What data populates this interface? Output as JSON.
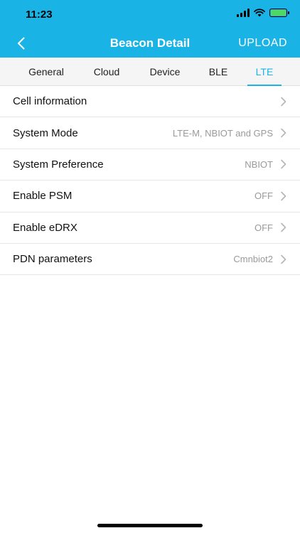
{
  "status_bar": {
    "time": "11:23"
  },
  "nav": {
    "title": "Beacon Detail",
    "action_label": "UPLOAD"
  },
  "tabs": [
    {
      "label": "General"
    },
    {
      "label": "Cloud"
    },
    {
      "label": "Device"
    },
    {
      "label": "BLE"
    },
    {
      "label": "LTE"
    }
  ],
  "active_tab": "LTE",
  "rows": [
    {
      "label": "Cell information",
      "value": ""
    },
    {
      "label": "System Mode",
      "value": "LTE-M, NBIOT and GPS"
    },
    {
      "label": "System Preference",
      "value": "NBIOT"
    },
    {
      "label": "Enable PSM",
      "value": "OFF"
    },
    {
      "label": "Enable eDRX",
      "value": "OFF"
    },
    {
      "label": "PDN parameters",
      "value": "Cmnbiot2"
    }
  ],
  "colors": {
    "accent": "#1ab3e6",
    "battery": "#4cd964"
  },
  "icons": {
    "back": "chevron-left-icon",
    "row_disclosure": "chevron-right-icon"
  }
}
